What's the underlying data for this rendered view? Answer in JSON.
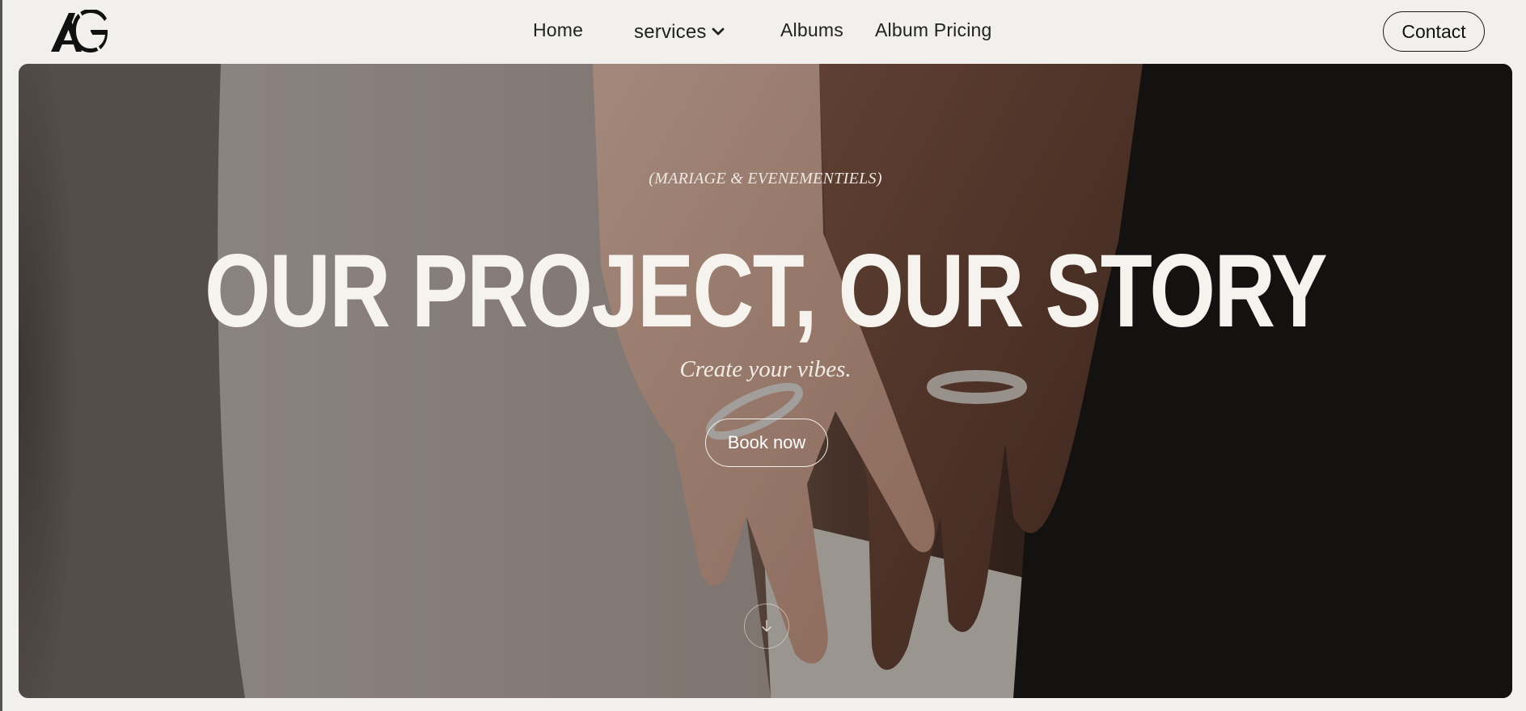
{
  "navbar": {
    "logo_text": "AG",
    "links": [
      {
        "label": "Home"
      },
      {
        "label": "services"
      },
      {
        "label": "Albums"
      },
      {
        "label": "Album Pricing"
      }
    ],
    "contact_label": "Contact"
  },
  "hero": {
    "eyebrow": "(MARIAGE & EVENEMENTIELS)",
    "title": "OUR PROJECT, OUR STORY",
    "subtitle": "Create your vibes.",
    "book_label": "Book now",
    "scroll_icon": "arrow-down-icon",
    "image_subject": "close-up of couple's hands with wedding rings"
  },
  "colors": {
    "page_background": "#f1f0ec",
    "text_dark": "#222222",
    "hero_text": "#f6f3ef"
  }
}
